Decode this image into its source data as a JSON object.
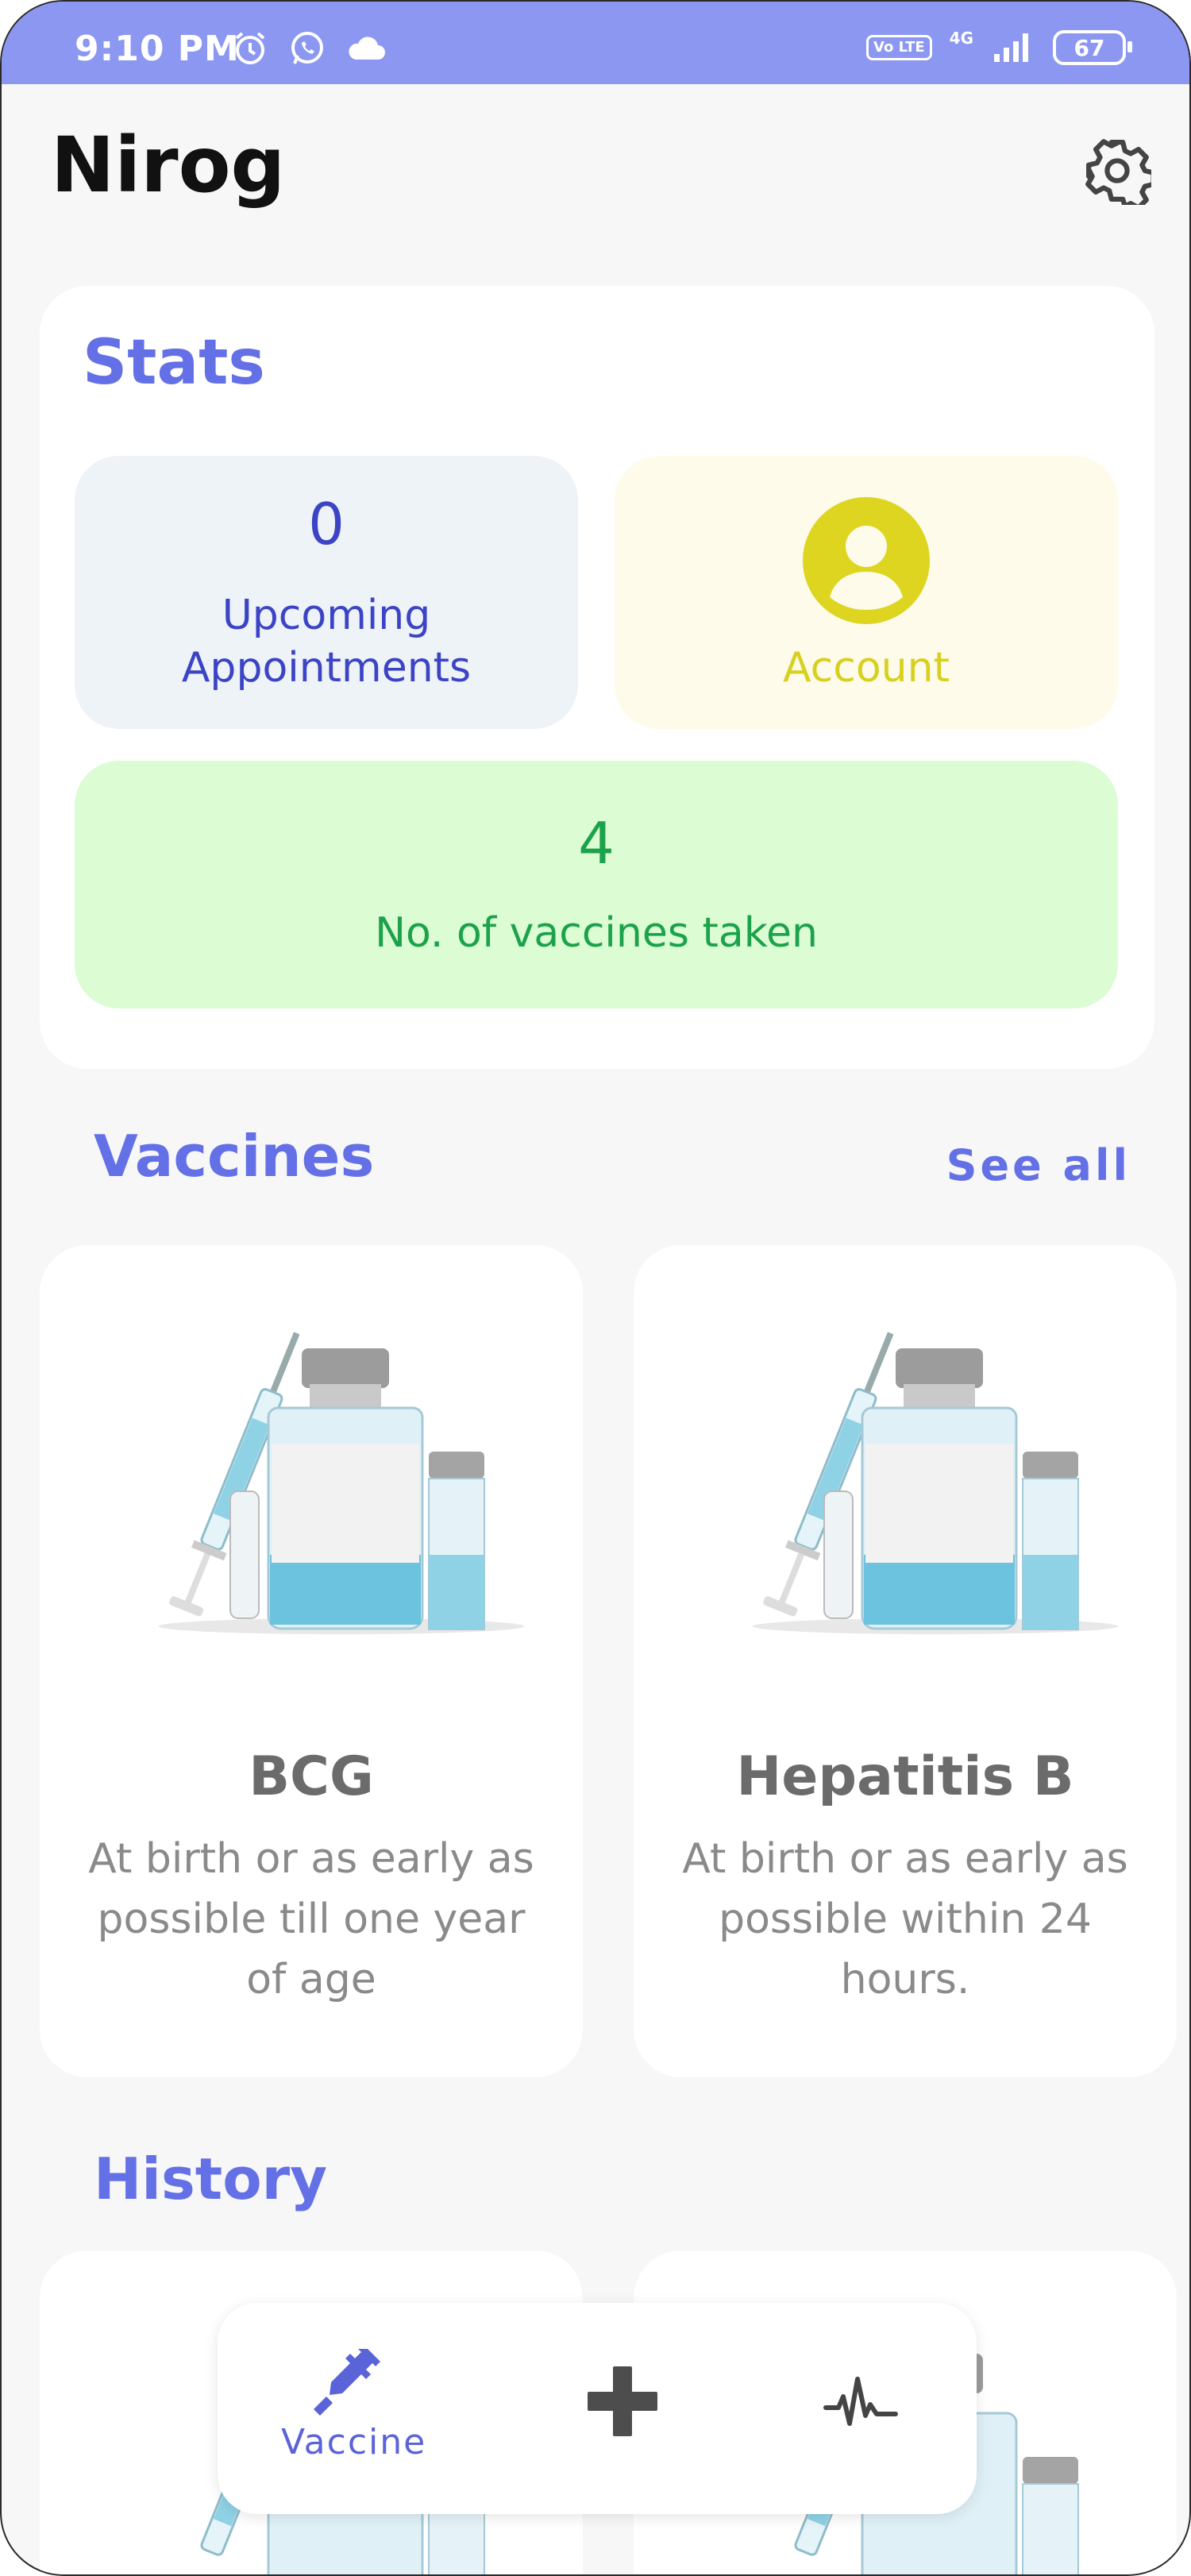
{
  "status_bar": {
    "time": "9:10 PM",
    "network": "4G",
    "volte": "Vo LTE",
    "battery": "67"
  },
  "header": {
    "title": "Nirog"
  },
  "stats": {
    "title": "Stats",
    "upcoming_count": "0",
    "upcoming_label_line1": "Upcoming",
    "upcoming_label_line2": "Appointments",
    "account_label": "Account",
    "vaccines_count": "4",
    "vaccines_label": "No. of vaccines taken"
  },
  "vaccines": {
    "title": "Vaccines",
    "see_all": "See all",
    "items": [
      {
        "name": "BCG",
        "desc": "At birth or as early as possible till one year of age"
      },
      {
        "name": "Hepatitis B",
        "desc": "At birth or as early as possible within 24 hours."
      }
    ]
  },
  "history": {
    "title": "History"
  },
  "bottom_nav": {
    "vaccine_label": "Vaccine",
    "active": "vaccine"
  },
  "colors": {
    "accent": "#6470e6",
    "status_bar": "#8b97f0",
    "account": "#d8d01f",
    "success": "#1ba24a"
  }
}
